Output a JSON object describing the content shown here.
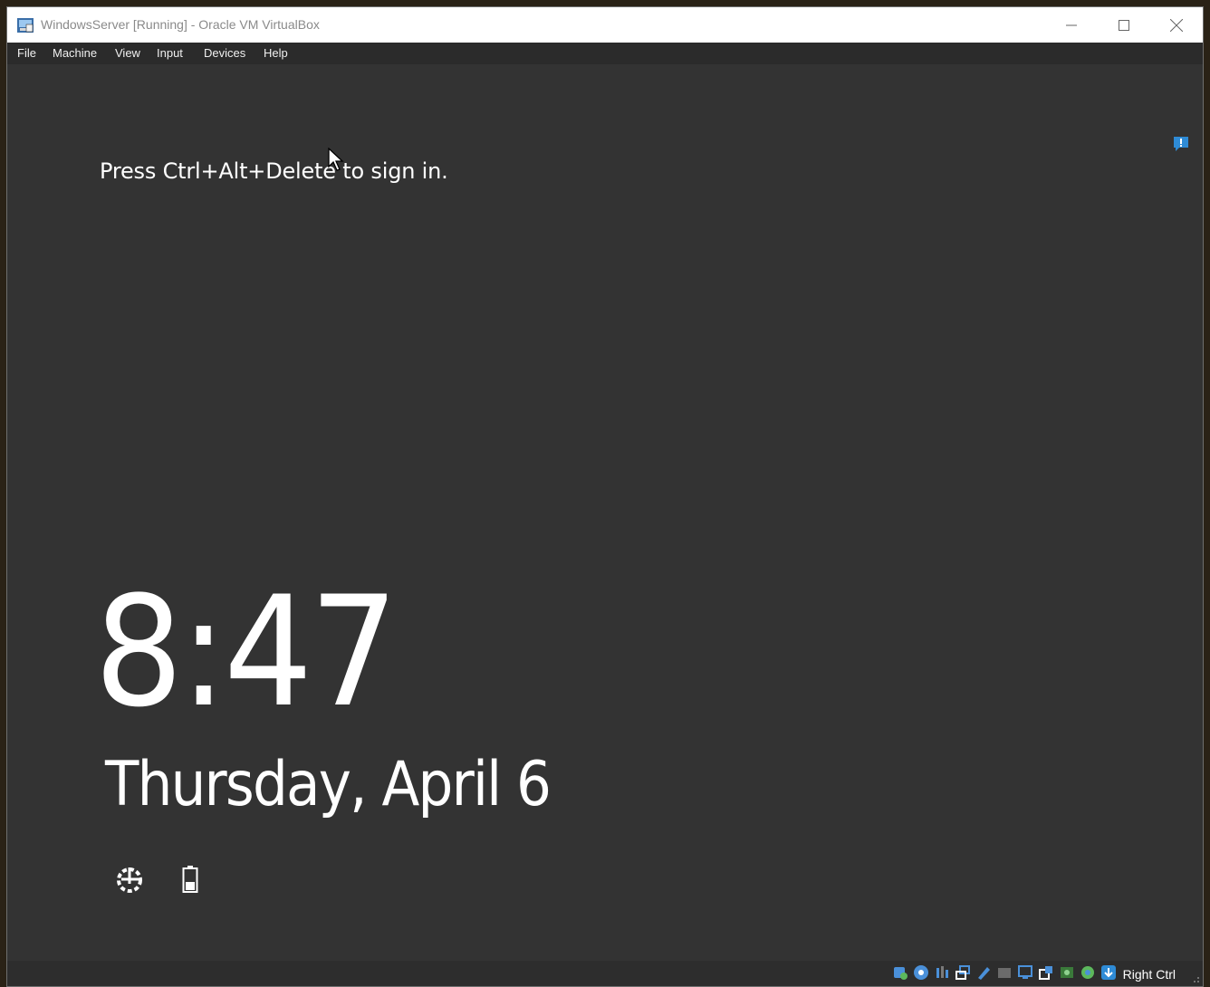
{
  "window": {
    "title": "WindowsServer [Running] - Oracle VM VirtualBox"
  },
  "menu": {
    "items": [
      "File",
      "Machine",
      "View",
      "Input",
      "Devices",
      "Help"
    ]
  },
  "lockscreen": {
    "prompt": "Press Ctrl+Alt+Delete to sign in.",
    "time": "8:47",
    "date": "Thursday, April 6"
  },
  "statusbar": {
    "host_key": "Right Ctrl",
    "icons": [
      "hard-disk-icon",
      "optical-drive-icon",
      "audio-icon",
      "network-icon",
      "usb-icon",
      "shared-folders-icon",
      "display-icon",
      "video-capture-icon",
      "recording-icon",
      "cpu-icon",
      "mouse-integration-icon",
      "keyboard-icon"
    ]
  },
  "colors": {
    "vm_background": "#333333",
    "menubar": "#2b2b2b",
    "titlebar": "#ffffff",
    "accent": "#2e8bd6"
  }
}
